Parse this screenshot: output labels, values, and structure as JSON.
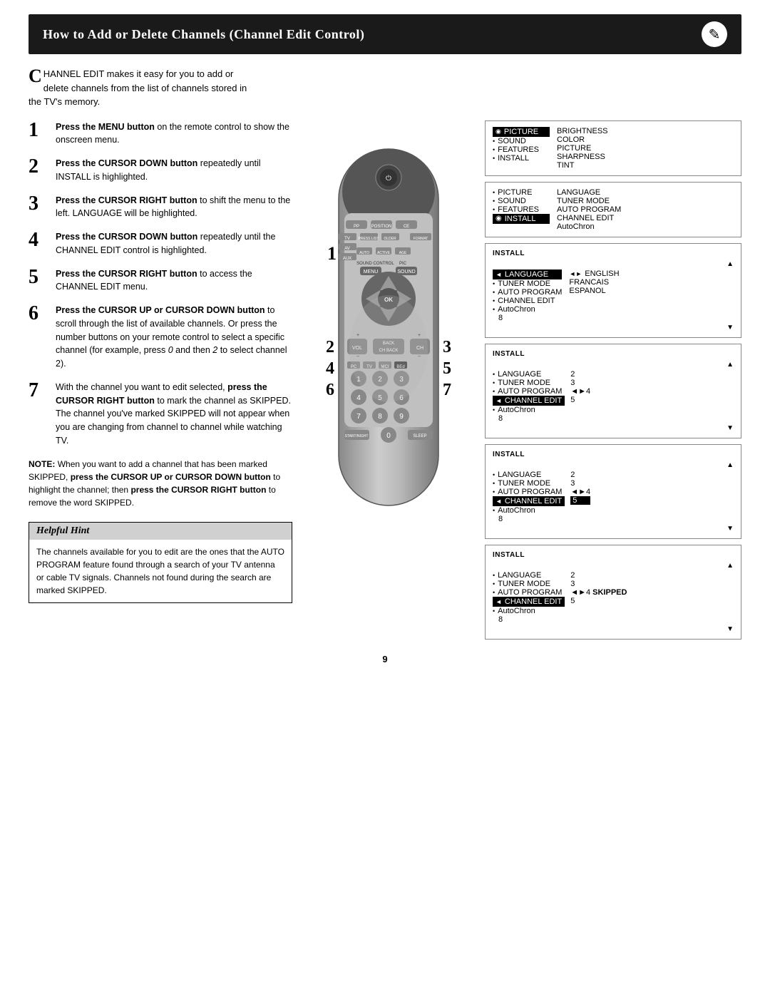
{
  "header": {
    "title": "How to Add or Delete Channels (Channel Edit Control)",
    "icon": "✎"
  },
  "intro": {
    "drop_cap": "C",
    "text": "HANNEL EDIT makes it easy for you to add or delete channels from the list of channels stored in the TV's memory."
  },
  "steps": [
    {
      "number": "1",
      "content": "Press the MENU button on the remote control to show the onscreen menu."
    },
    {
      "number": "2",
      "bold": "Press the CURSOR DOWN button",
      "content": " repeatedly until INSTALL is highlighted."
    },
    {
      "number": "3",
      "bold": "Press the CURSOR RIGHT button",
      "content": " to shift the menu to the left. LANGUAGE will be highlighted."
    },
    {
      "number": "4",
      "bold": "Press the CURSOR DOWN button",
      "content": " repeatedly until the CHANNEL EDIT control is highlighted."
    },
    {
      "number": "5",
      "bold": "Press the CURSOR RIGHT button",
      "content": " to access the CHANNEL EDIT menu."
    },
    {
      "number": "6",
      "bold": "Press the CURSOR UP or CURSOR DOWN button",
      "content": " to scroll through the list of available channels. Or press the number buttons on your remote control to select a specific channel (for example, press 0 and then 2 to select channel 2)."
    },
    {
      "number": "7",
      "content_parts": [
        "With the channel you want to edit selected, ",
        "press the CURSOR RIGHT button",
        " to mark the channel as SKIPPED. The channel you've marked SKIPPED will not appear when you are changing from channel to channel while watching TV."
      ]
    }
  ],
  "note": {
    "label": "NOTE:",
    "text": " When you want to add a channel that has been marked SKIPPED, press the CURSOR UP or CURSOR DOWN button to highlight the channel; then press the CURSOR RIGHT button to remove the word SKIPPED."
  },
  "helpful_hint": {
    "title": "Helpful Hint",
    "body": "The channels available for you to edit are the ones that the AUTO PROGRAM feature found through a search of your TV antenna or cable TV signals. Channels not found during the search are marked SKIPPED."
  },
  "menu_screens": {
    "screen1": {
      "items_left": [
        "PICTURE",
        "SOUND",
        "FEATURES",
        "INSTALL"
      ],
      "items_right": [
        "BRIGHTNESS",
        "COLOR",
        "PICTURE",
        "SHARPNESS",
        "TINT"
      ],
      "active_left": "PICTURE"
    },
    "screen2": {
      "title": "INSTALL",
      "items_left": [
        "PICTURE",
        "SOUND",
        "FEATURES",
        "INSTALL"
      ],
      "items_right": [
        "LANGUAGE",
        "TUNER MODE",
        "AUTO PROGRAM",
        "CHANNEL EDIT",
        "AutoChron"
      ],
      "active_left": "INSTALL",
      "active_right": null
    },
    "screen3": {
      "title": "INSTALL",
      "items": [
        "LANGUAGE",
        "TUNER MODE",
        "AUTO PROGRAM",
        "CHANNEL EDIT",
        "AutoChron",
        "8"
      ],
      "values": [
        "",
        "",
        "",
        "",
        "",
        ""
      ],
      "active": "LANGUAGE",
      "right_values": [
        "ENGLISH",
        "FRANCAIS",
        "ESPANOL"
      ]
    },
    "screen4": {
      "title": "INSTALL",
      "items": [
        "LANGUAGE",
        "TUNER MODE",
        "AUTO PROGRAM",
        "CHANNEL EDIT",
        "AutoChron",
        "8"
      ],
      "values": [
        "",
        "2",
        "3",
        "◄►4",
        "5",
        ""
      ],
      "active": "CHANNEL EDIT"
    },
    "screen5": {
      "title": "INSTALL",
      "items": [
        "LANGUAGE",
        "TUNER MODE",
        "AUTO PROGRAM",
        "CHANNEL EDIT",
        "AutoChron",
        "8"
      ],
      "values": [
        "",
        "2",
        "3",
        "◄►4",
        "5",
        ""
      ],
      "active": "CHANNEL EDIT",
      "highlighted_val": "5"
    },
    "screen6": {
      "title": "INSTALL",
      "items": [
        "LANGUAGE",
        "TUNER MODE",
        "AUTO PROGRAM",
        "CHANNEL EDIT",
        "AutoChron",
        "8"
      ],
      "values": [
        "",
        "2",
        "3",
        "◄►4 SKIPPED",
        "5",
        ""
      ],
      "active": "CHANNEL EDIT"
    }
  },
  "page_number": "9"
}
